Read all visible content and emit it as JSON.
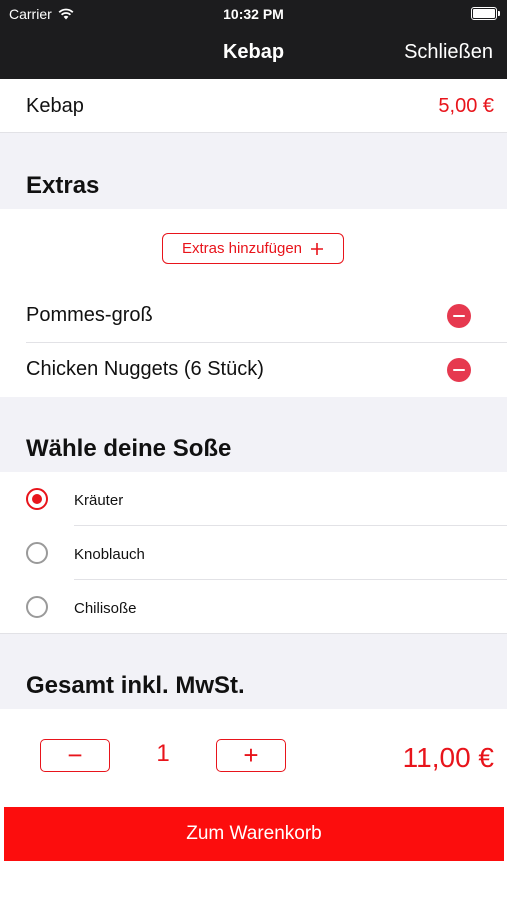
{
  "status": {
    "carrier": "Carrier",
    "time": "10:32 PM"
  },
  "nav": {
    "title": "Kebap",
    "close": "Schließen"
  },
  "item": {
    "name": "Kebap",
    "price": "5,00 €"
  },
  "extras": {
    "title": "Extras",
    "add_label": "Extras hinzufügen",
    "items": [
      {
        "name": "Pommes-groß"
      },
      {
        "name": "Chicken Nuggets (6 Stück)"
      }
    ]
  },
  "sauce": {
    "title": "Wähle deine Soße",
    "options": [
      {
        "label": "Kräuter",
        "selected": true
      },
      {
        "label": "Knoblauch",
        "selected": false
      },
      {
        "label": "Chilisoße",
        "selected": false
      }
    ]
  },
  "total": {
    "title": "Gesamt inkl. MwSt.",
    "quantity": "1",
    "amount": "11,00 €",
    "minus": "−",
    "plus": "+"
  },
  "cart_button": "Zum Warenkorb",
  "colors": {
    "accent": "#e8141b",
    "nav_bg": "#1c1c1e",
    "section_bg": "#f2f2f7",
    "remove": "#e6394f"
  }
}
